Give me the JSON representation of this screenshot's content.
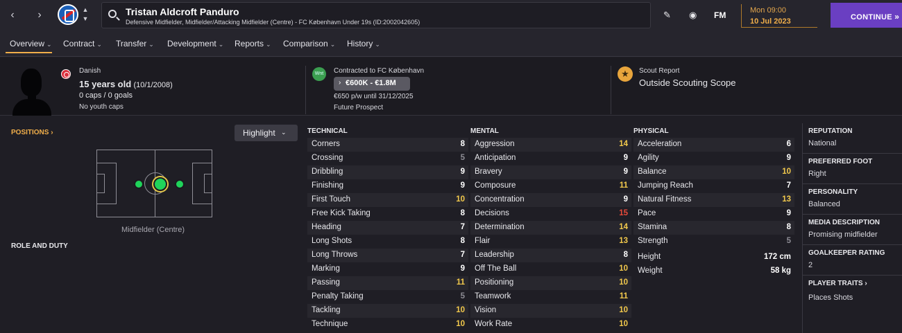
{
  "player": {
    "name": "Tristan Aldcroft Panduro",
    "subtitle": "Defensive Midfielder, Midfielder/Attacking Midfielder (Centre) - FC København Under 19s (ID:2002042605)",
    "nationality": "Danish",
    "age": "15 years old",
    "dob": "(10/1/2008)",
    "caps_goals": "0 caps / 0 goals",
    "youth_caps": "No youth caps"
  },
  "contract": {
    "club": "Contracted to FC København",
    "value_range": "€600K - €1.8M",
    "wage": "€650 p/w until 31/12/2025",
    "status": "Future Prospect",
    "icon_text": "Wnt"
  },
  "scout": {
    "title": "Scout Report",
    "value": "Outside Scouting Scope"
  },
  "topbar": {
    "fm": "FM",
    "day_time": "Mon 09:00",
    "date": "10 Jul 2023",
    "continue": "CONTINUE"
  },
  "tabs": [
    {
      "label": "Overview"
    },
    {
      "label": "Contract"
    },
    {
      "label": "Transfer"
    },
    {
      "label": "Development"
    },
    {
      "label": "Reports"
    },
    {
      "label": "Comparison"
    },
    {
      "label": "History"
    }
  ],
  "left": {
    "positions_label": "POSITIONS",
    "highlight": "Highlight",
    "position_caption": "Midfielder (Centre)",
    "role_label": "ROLE AND DUTY"
  },
  "technical": {
    "title": "TECHNICAL",
    "rows": [
      {
        "name": "Corners",
        "value": "8"
      },
      {
        "name": "Crossing",
        "value": "5"
      },
      {
        "name": "Dribbling",
        "value": "9"
      },
      {
        "name": "Finishing",
        "value": "9"
      },
      {
        "name": "First Touch",
        "value": "10"
      },
      {
        "name": "Free Kick Taking",
        "value": "8"
      },
      {
        "name": "Heading",
        "value": "7"
      },
      {
        "name": "Long Shots",
        "value": "8"
      },
      {
        "name": "Long Throws",
        "value": "7"
      },
      {
        "name": "Marking",
        "value": "9"
      },
      {
        "name": "Passing",
        "value": "11"
      },
      {
        "name": "Penalty Taking",
        "value": "5"
      },
      {
        "name": "Tackling",
        "value": "10"
      },
      {
        "name": "Technique",
        "value": "10"
      }
    ]
  },
  "mental": {
    "title": "MENTAL",
    "rows": [
      {
        "name": "Aggression",
        "value": "14"
      },
      {
        "name": "Anticipation",
        "value": "9"
      },
      {
        "name": "Bravery",
        "value": "9"
      },
      {
        "name": "Composure",
        "value": "11"
      },
      {
        "name": "Concentration",
        "value": "9"
      },
      {
        "name": "Decisions",
        "value": "15"
      },
      {
        "name": "Determination",
        "value": "14"
      },
      {
        "name": "Flair",
        "value": "13"
      },
      {
        "name": "Leadership",
        "value": "8"
      },
      {
        "name": "Off The Ball",
        "value": "10"
      },
      {
        "name": "Positioning",
        "value": "10"
      },
      {
        "name": "Teamwork",
        "value": "11"
      },
      {
        "name": "Vision",
        "value": "10"
      },
      {
        "name": "Work Rate",
        "value": "10"
      }
    ]
  },
  "physical": {
    "title": "PHYSICAL",
    "rows": [
      {
        "name": "Acceleration",
        "value": "6"
      },
      {
        "name": "Agility",
        "value": "9"
      },
      {
        "name": "Balance",
        "value": "10"
      },
      {
        "name": "Jumping Reach",
        "value": "7"
      },
      {
        "name": "Natural Fitness",
        "value": "13"
      },
      {
        "name": "Pace",
        "value": "9"
      },
      {
        "name": "Stamina",
        "value": "8"
      },
      {
        "name": "Strength",
        "value": "5"
      }
    ],
    "height_label": "Height",
    "height": "172 cm",
    "weight_label": "Weight",
    "weight": "58 kg"
  },
  "info": [
    {
      "title": "REPUTATION",
      "value": "National"
    },
    {
      "title": "PREFERRED FOOT",
      "value": "Right"
    },
    {
      "title": "PERSONALITY",
      "value": "Balanced"
    },
    {
      "title": "MEDIA DESCRIPTION",
      "value": "Promising midfielder"
    },
    {
      "title": "GOALKEEPER RATING",
      "value": "2"
    },
    {
      "title": "PLAYER TRAITS",
      "value": "Places Shots"
    }
  ],
  "colors": {
    "low": "#8d8c94",
    "mid": "#ffffff",
    "good": "#f2c94c",
    "high": "#e84a3a",
    "accent": "#f0ae4a",
    "continue": "#6a3fc2"
  }
}
